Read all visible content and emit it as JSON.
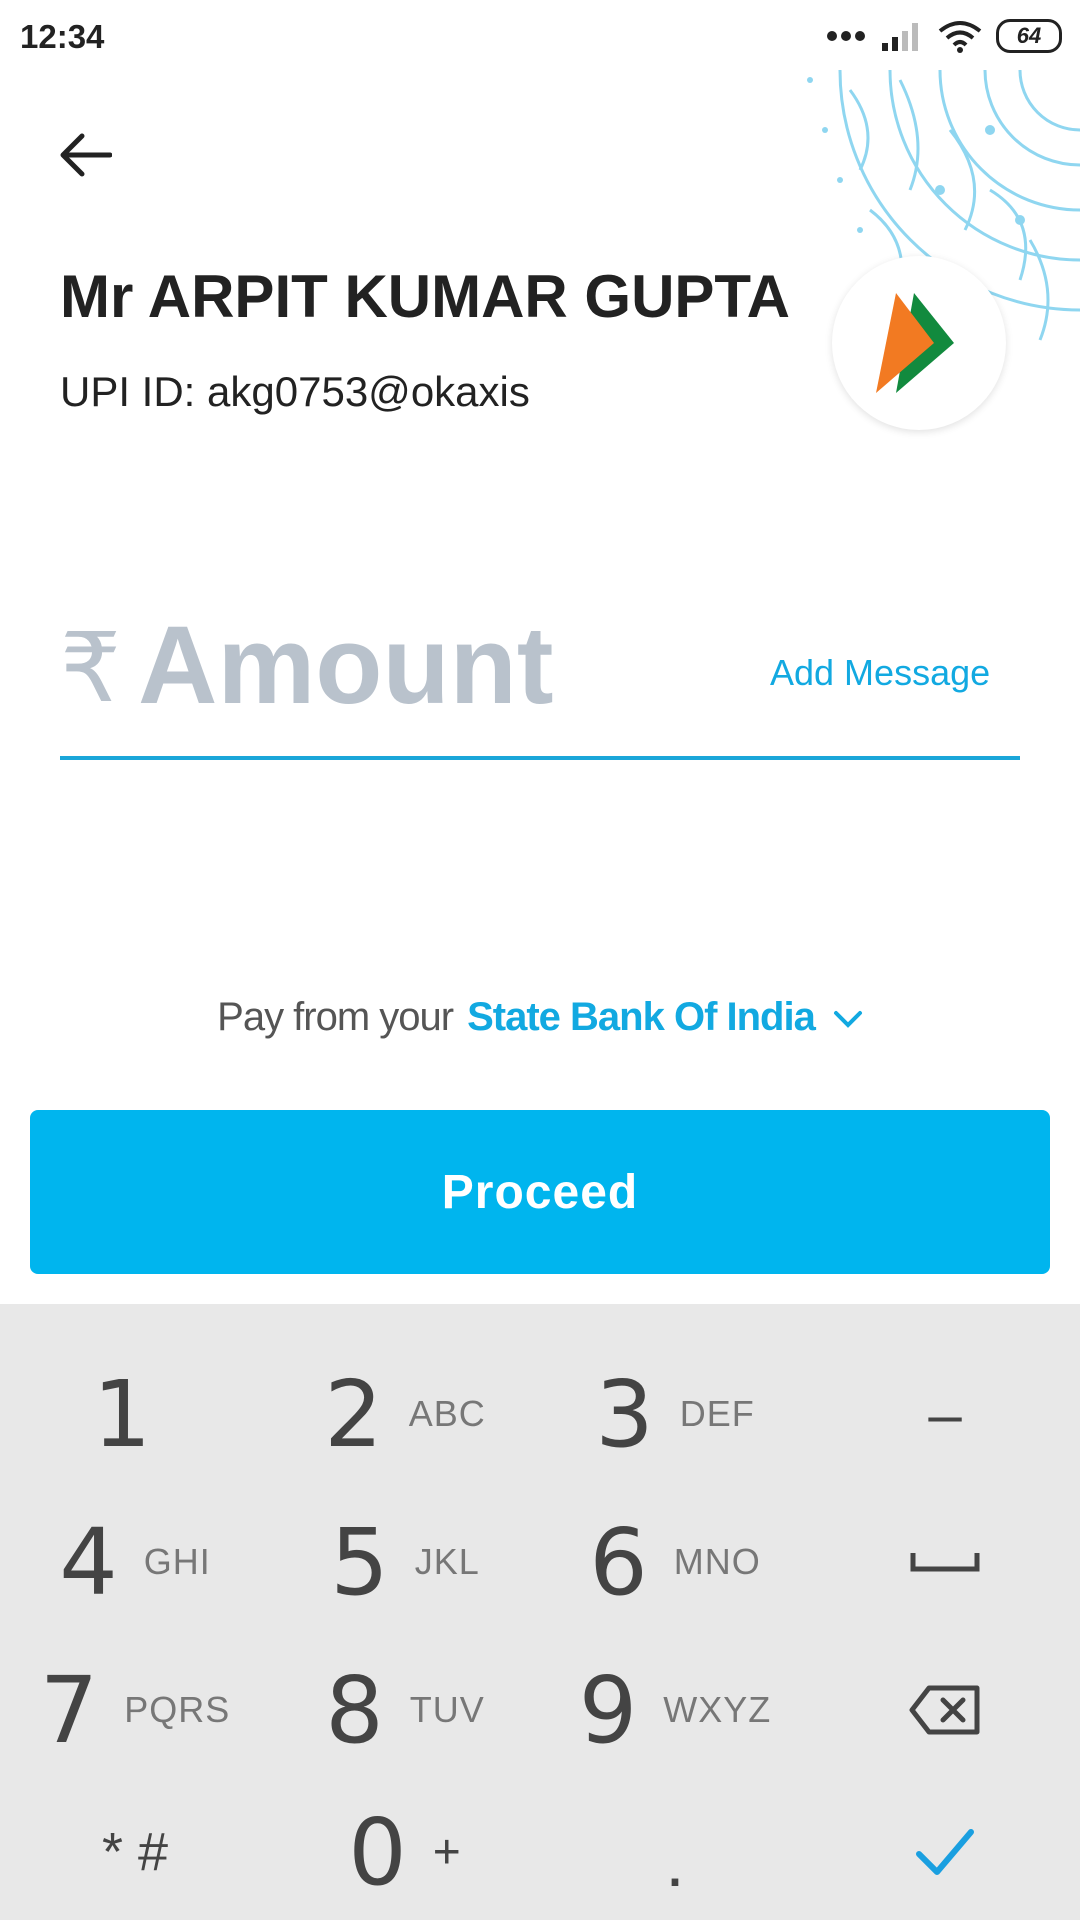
{
  "status_bar": {
    "time": "12:34",
    "battery": "64"
  },
  "header": {
    "payee_name": "Mr ARPIT KUMAR GUPTA",
    "upi_id_label": "UPI ID:",
    "upi_id": "akg0753@okaxis"
  },
  "amount": {
    "currency_symbol": "₹",
    "placeholder": "Amount",
    "value": "",
    "add_message_label": "Add Message"
  },
  "pay_from": {
    "label": "Pay from your",
    "bank": "State Bank Of India"
  },
  "proceed_label": "Proceed",
  "keypad": {
    "rows": [
      [
        {
          "digit": "1",
          "letters": ""
        },
        {
          "digit": "2",
          "letters": "ABC"
        },
        {
          "digit": "3",
          "letters": "DEF"
        },
        {
          "symbol": "–"
        }
      ],
      [
        {
          "digit": "4",
          "letters": "GHI"
        },
        {
          "digit": "5",
          "letters": "JKL"
        },
        {
          "digit": "6",
          "letters": "MNO"
        },
        {
          "icon": "space-icon"
        }
      ],
      [
        {
          "digit": "7",
          "letters": "PQRS"
        },
        {
          "digit": "8",
          "letters": "TUV"
        },
        {
          "digit": "9",
          "letters": "WXYZ"
        },
        {
          "icon": "backspace-icon"
        }
      ],
      [
        {
          "symbol": "* #"
        },
        {
          "digit": "0",
          "letters": "+"
        },
        {
          "symbol": "."
        },
        {
          "icon": "check-icon"
        }
      ]
    ]
  },
  "colors": {
    "accent": "#00b5ee",
    "link": "#12a9e1",
    "placeholder": "#b9c2cc",
    "keypad_bg": "#e8e8e8"
  }
}
